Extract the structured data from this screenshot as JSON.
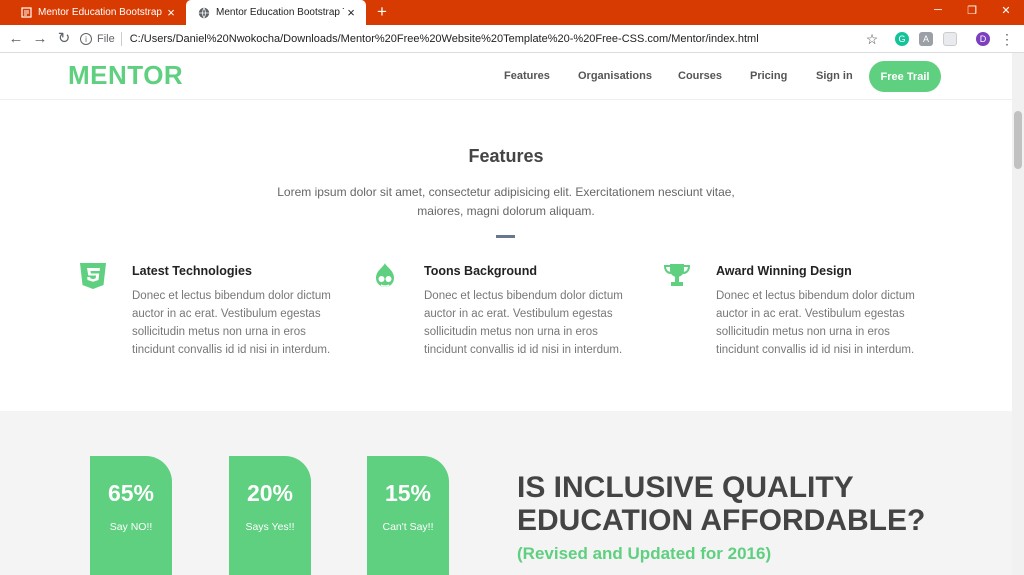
{
  "browser": {
    "tabs": [
      {
        "title": "Mentor Education Bootstrap The",
        "active": false
      },
      {
        "title": "Mentor Education Bootstrap The",
        "active": true
      }
    ],
    "new_tab": "+",
    "address": {
      "scheme_label": "File",
      "url": "C:/Users/Daniel%20Nwokocha/Downloads/Mentor%20Free%20Website%20Template%20-%20Free-CSS.com/Mentor/index.html"
    },
    "profile_initial": "D"
  },
  "site": {
    "logo": "MENTOR",
    "nav": [
      "Features",
      "Organisations",
      "Courses",
      "Pricing",
      "Sign in"
    ],
    "cta": "Free Trail",
    "accent": "#5fcf80"
  },
  "features": {
    "title": "Features",
    "subtitle": "Lorem ipsum dolor sit amet, consectetur adipisicing elit. Exercitationem nesciunt vitae, maiores, magni dolorum aliquam.",
    "items": [
      {
        "icon": "css3-icon",
        "title": "Latest Technologies",
        "text": "Donec et lectus bibendum dolor dictum auctor in ac erat. Vestibulum egestas sollicitudin metus non urna in eros tincidunt convallis id id nisi in interdum."
      },
      {
        "icon": "drupal-icon",
        "title": "Toons Background",
        "text": "Donec et lectus bibendum dolor dictum auctor in ac erat. Vestibulum egestas sollicitudin metus non urna in eros tincidunt convallis id id nisi in interdum."
      },
      {
        "icon": "trophy-icon",
        "title": "Award Winning Design",
        "text": "Donec et lectus bibendum dolor dictum auctor in ac erat. Vestibulum egestas sollicitudin metus non urna in eros tincidunt convallis id id nisi in interdum."
      }
    ]
  },
  "stats": {
    "items": [
      {
        "value": "65%",
        "label": "Say NO!!"
      },
      {
        "value": "20%",
        "label": "Says Yes!!"
      },
      {
        "value": "15%",
        "label": "Can't Say!!"
      }
    ],
    "headline_line1": "IS INCLUSIVE QUALITY",
    "headline_line2": "EDUCATION AFFORDABLE?",
    "subheadline": "(Revised and Updated for 2016)"
  }
}
